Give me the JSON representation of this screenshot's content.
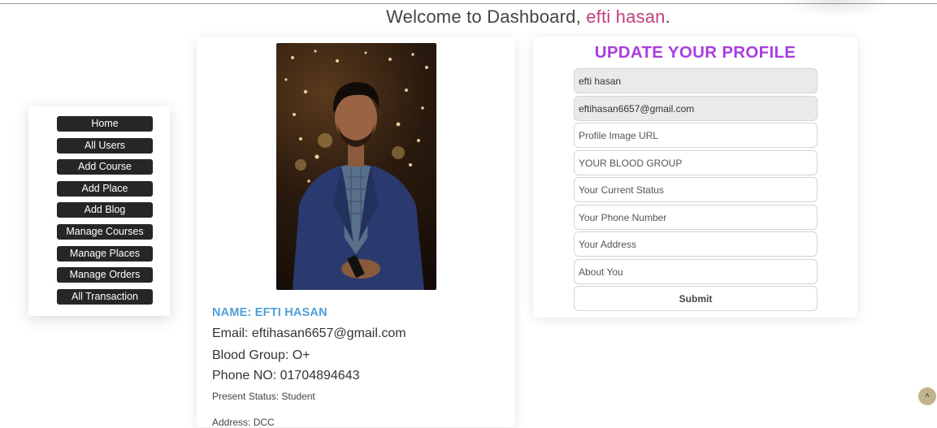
{
  "header": {
    "welcome_prefix": "Welcome to Dashboard, ",
    "user_name": "efti hasan",
    "suffix": "."
  },
  "sidebar": {
    "items": [
      {
        "label": "Home"
      },
      {
        "label": "All Users"
      },
      {
        "label": "Add Course"
      },
      {
        "label": "Add Place"
      },
      {
        "label": "Add Blog"
      },
      {
        "label": "Manage Courses"
      },
      {
        "label": "Manage Places"
      },
      {
        "label": "Manage Orders"
      },
      {
        "label": "All Transaction"
      }
    ]
  },
  "profile": {
    "name": "NAME: EFTI HASAN",
    "email": "Email: eftihasan6657@gmail.com",
    "blood_group": "Blood Group: O+",
    "phone": "Phone NO: 01704894643",
    "status": "Present Status: Student",
    "address": "Address: DCC"
  },
  "update_form": {
    "title": "UPDATE YOUR PROFILE",
    "name_value": "efti hasan",
    "email_value": "eftihasan6657@gmail.com",
    "image_placeholder": "Profile Image URL",
    "blood_placeholder": "YOUR BLOOD GROUP",
    "status_placeholder": "Your Current Status",
    "phone_placeholder": "Your Phone Number",
    "address_placeholder": "Your Address",
    "about_placeholder": "About You",
    "submit_label": "Submit"
  },
  "scroll_top": {
    "icon": "chevron-up-icon",
    "glyph": "˄"
  },
  "colors": {
    "user_name": "#c2407e",
    "title": "#a93de0",
    "profile_name": "#4f9fd8",
    "nav_button": "#262626"
  }
}
